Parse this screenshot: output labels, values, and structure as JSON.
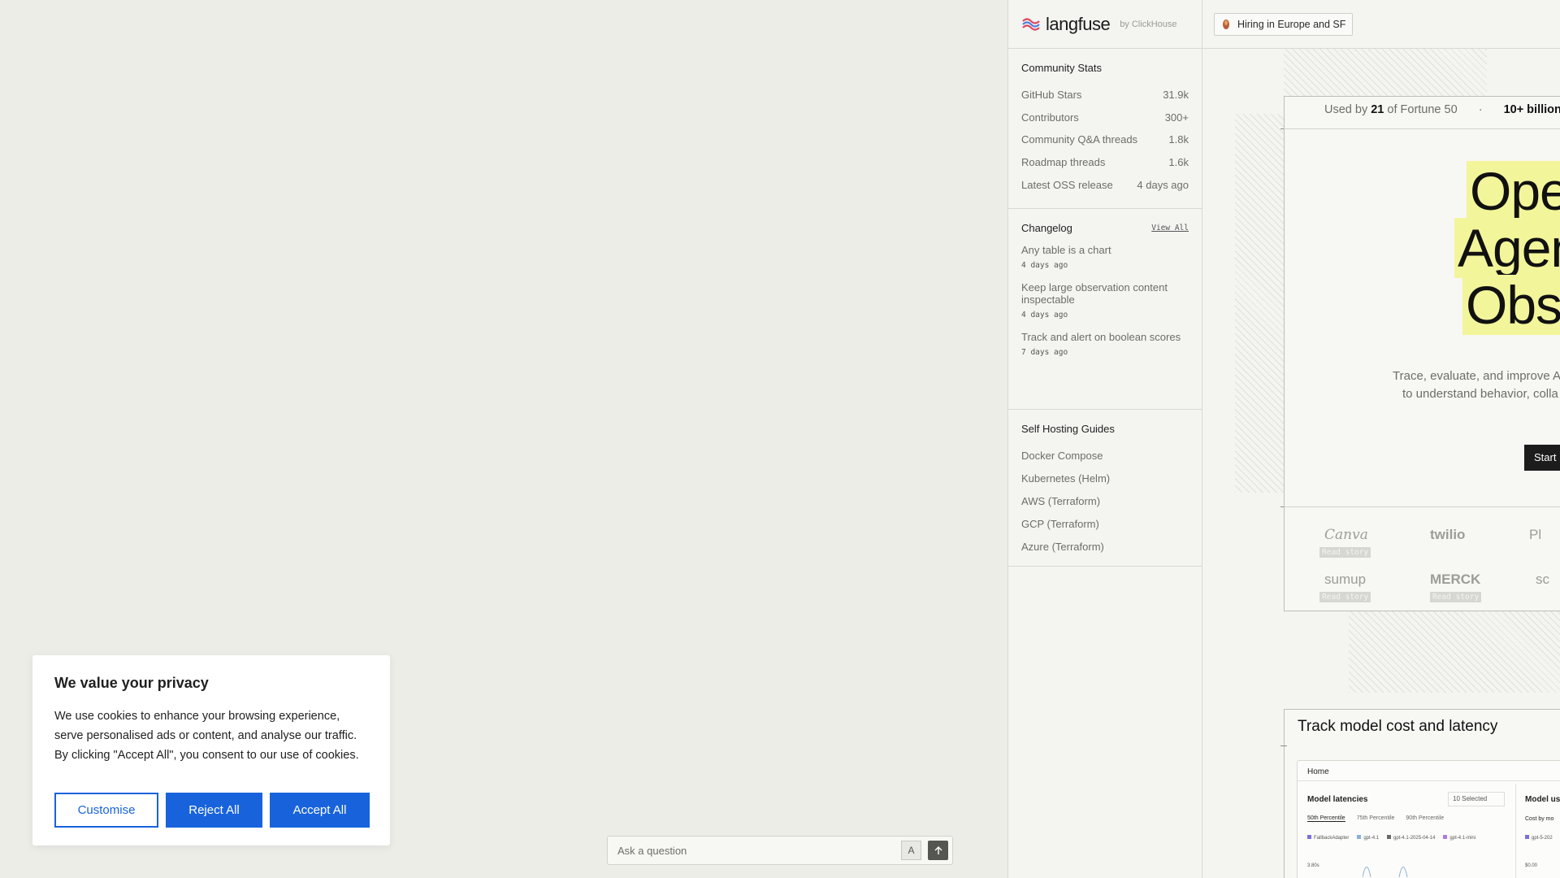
{
  "sidebar": {
    "logo": {
      "name": "langfuse",
      "by": "by ClickHouse"
    },
    "community": {
      "title": "Community Stats",
      "stats": [
        {
          "label": "GitHub Stars",
          "value": "31.9k"
        },
        {
          "label": "Contributors",
          "value": "300+"
        },
        {
          "label": "Community Q&A threads",
          "value": "1.8k"
        },
        {
          "label": "Roadmap threads",
          "value": "1.6k"
        },
        {
          "label": "Latest OSS release",
          "value": "4 days ago"
        }
      ]
    },
    "changelog": {
      "title": "Changelog",
      "view_all": "View All",
      "items": [
        {
          "title": "Any table is a chart",
          "date": "4 days ago"
        },
        {
          "title": "Keep large observation content inspectable",
          "date": "4 days ago"
        },
        {
          "title": "Track and alert on boolean scores",
          "date": "7 days ago"
        }
      ]
    },
    "self_hosting": {
      "title": "Self Hosting Guides",
      "items": [
        "Docker Compose",
        "Kubernetes (Helm)",
        "AWS (Terraform)",
        "GCP (Terraform)",
        "Azure (Terraform)"
      ]
    }
  },
  "main": {
    "hiring": "Hiring in Europe and SF",
    "used_by": {
      "prefix": "Used by",
      "count": "21",
      "suffix": "of Fortune 50",
      "sep": "·",
      "stat": "10+ billion"
    },
    "hero": {
      "line1": "Ope",
      "line2": "Agen",
      "line3": "Obs"
    },
    "hero_sub": {
      "line1": "Trace, evaluate, and improve A",
      "line2": "to understand behavior, colla"
    },
    "start_button": "Start",
    "logos": [
      {
        "name": "Canva",
        "story": "Read story"
      },
      {
        "name": "twilio",
        "story": ""
      },
      {
        "name": "Pl",
        "story": ""
      },
      {
        "name": "sumup",
        "story": "Read story"
      },
      {
        "name": "MERCK",
        "story": "Read story"
      },
      {
        "name": "sc",
        "story": ""
      }
    ],
    "track": {
      "title": "Track model cost and latency",
      "dashboard": {
        "home": "Home",
        "panel_title": "Model latencies",
        "select": "10 Selected",
        "tabs": [
          "50th Percentile",
          "75th Percentile",
          "90th Percentile"
        ],
        "legend": [
          "FallbackAdapter",
          "gpt-4.1",
          "gpt-4.1-2025-04-14",
          "gpt-4.1-mini"
        ],
        "y_label": "3.80s",
        "right_title": "Model us",
        "right_sub": "Cost by mo",
        "right_legend": "gpt-5-202",
        "right_value": "$0.00"
      }
    }
  },
  "cookie": {
    "title": "We value your privacy",
    "text": "We use cookies to enhance your browsing experience, serve personalised ads or content, and analyse our traffic. By clicking \"Accept All\", you consent to our use of cookies.",
    "customise": "Customise",
    "reject": "Reject All",
    "accept": "Accept All"
  },
  "ask": {
    "placeholder": "Ask a question",
    "shortcut": "A",
    "send_icon": "arrow-up-icon"
  },
  "colors": {
    "accent": "#1863dc",
    "highlight": "#f3f59a"
  }
}
